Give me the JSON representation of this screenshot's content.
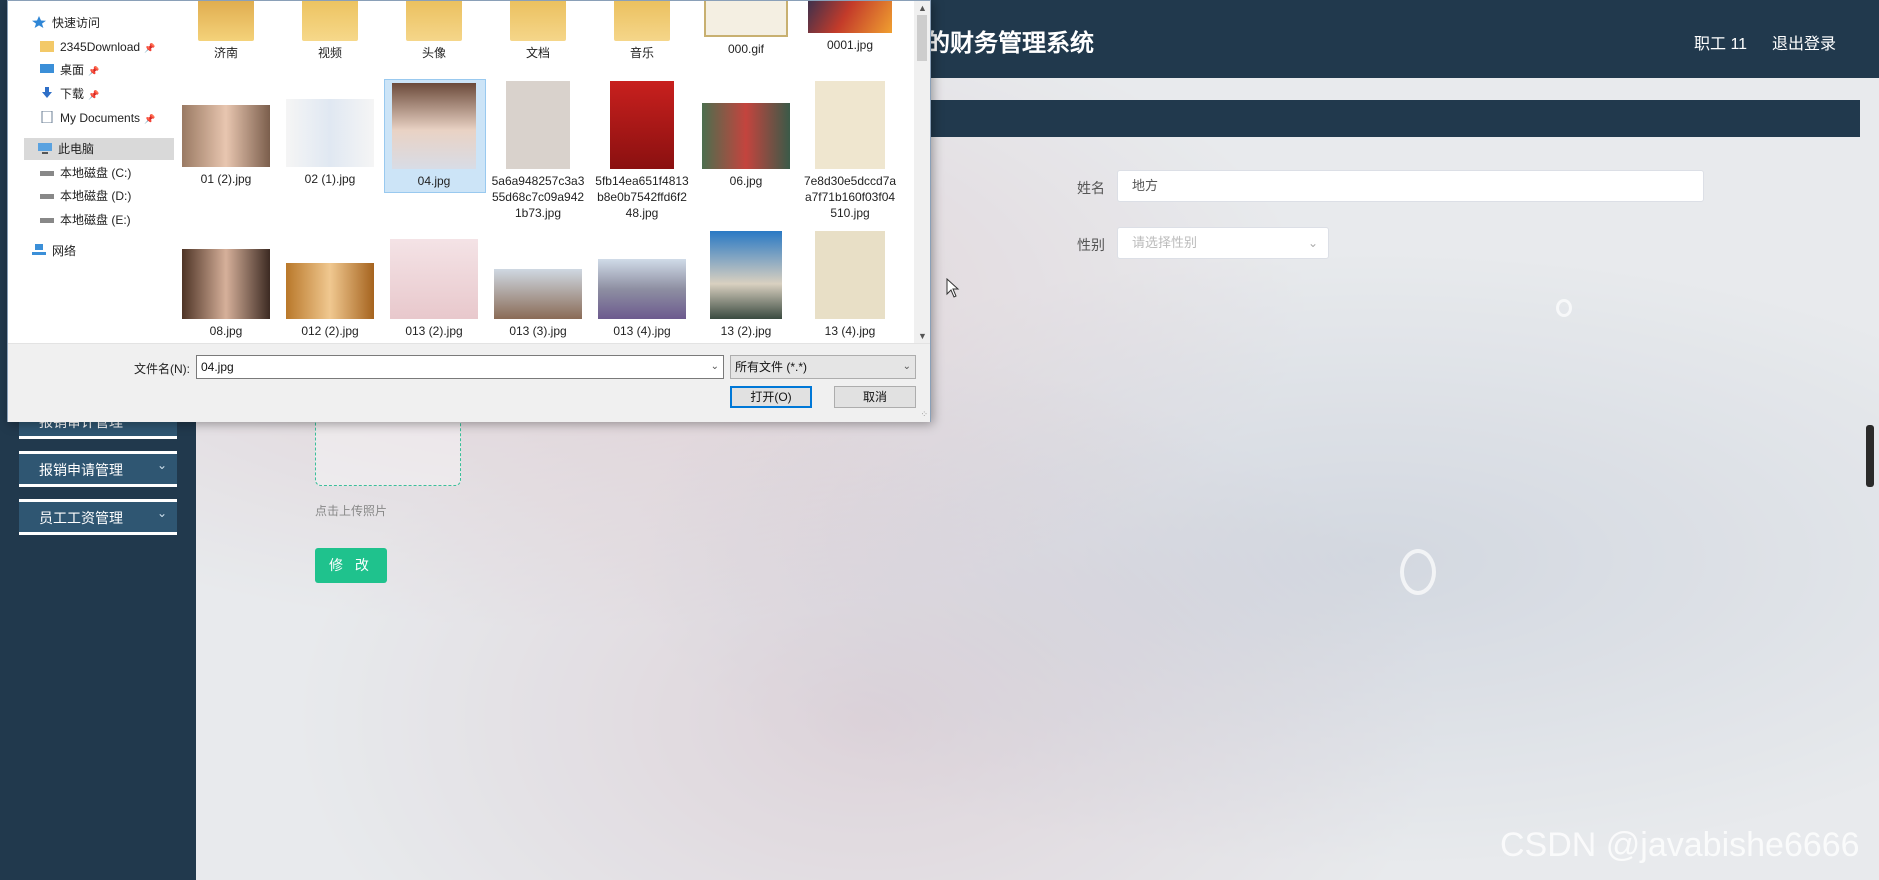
{
  "app": {
    "title": "的财务管理系统",
    "user": "职工 11",
    "logout": "退出登录",
    "sidebar": [
      {
        "label": "报销审计管理"
      },
      {
        "label": "报销申请管理"
      },
      {
        "label": "员工工资管理"
      }
    ],
    "form": {
      "name_label": "姓名",
      "name_value": "地方",
      "gender_label": "性别",
      "gender_placeholder": "请选择性别",
      "upload_hint": "点击上传照片",
      "submit_label": "修 改"
    },
    "watermark": "CSDN @javabishe6666"
  },
  "dialog": {
    "nav": [
      {
        "label": "快速访问",
        "icon": "star-icon"
      },
      {
        "label": "2345Download",
        "icon": "folder-icon",
        "pinned": true
      },
      {
        "label": "桌面",
        "icon": "desktop-icon",
        "pinned": true
      },
      {
        "label": "下载",
        "icon": "download-icon",
        "pinned": true
      },
      {
        "label": "My Documents",
        "icon": "document-icon",
        "pinned": true
      },
      {
        "label": "此电脑",
        "icon": "computer-icon",
        "selected": true
      },
      {
        "label": "本地磁盘 (C:)",
        "icon": "drive-icon"
      },
      {
        "label": "本地磁盘 (D:)",
        "icon": "drive-icon"
      },
      {
        "label": "本地磁盘 (E:)",
        "icon": "drive-icon"
      },
      {
        "label": "网络",
        "icon": "network-icon"
      }
    ],
    "files_row1": [
      {
        "name": "济南",
        "kind": "folder"
      },
      {
        "name": "视频",
        "kind": "folder"
      },
      {
        "name": "头像",
        "kind": "folder"
      },
      {
        "name": "文档",
        "kind": "folder"
      },
      {
        "name": "音乐",
        "kind": "folder"
      },
      {
        "name": "000.gif",
        "kind": "image"
      },
      {
        "name": "0001.jpg",
        "kind": "image"
      }
    ],
    "files_row2": [
      {
        "name": "01 (2).jpg"
      },
      {
        "name": "02 (1).jpg"
      },
      {
        "name": "04.jpg",
        "selected": true
      },
      {
        "name": "5a6a948257c3a355d68c7c09a9421b73.jpg"
      },
      {
        "name": "5fb14ea651f4813b8e0b7542ffd6f248.jpg"
      },
      {
        "name": "06.jpg"
      },
      {
        "name": "7e8d30e5dccd7aa7f71b160f03f04510.jpg"
      }
    ],
    "files_row3": [
      {
        "name": "08.jpg"
      },
      {
        "name": "012 (2).jpg"
      },
      {
        "name": "013 (2).jpg"
      },
      {
        "name": "013 (3).jpg"
      },
      {
        "name": "013 (4).jpg"
      },
      {
        "name": "13 (2).jpg"
      },
      {
        "name": "13 (4).jpg"
      }
    ],
    "filename_label": "文件名(N):",
    "filename_value": "04.jpg",
    "filetype_value": "所有文件 (*.*)",
    "open_label": "打开(O)",
    "cancel_label": "取消"
  }
}
